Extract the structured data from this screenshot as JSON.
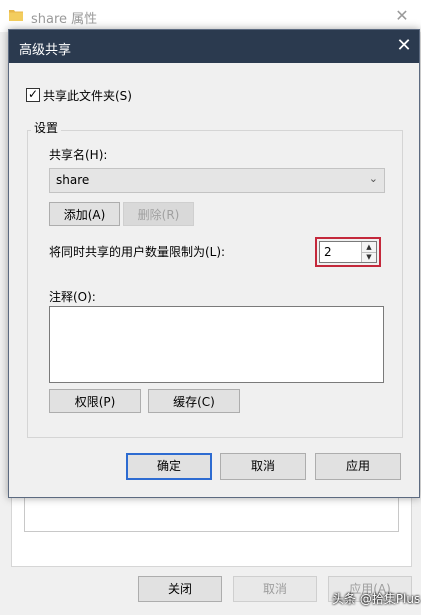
{
  "background_window": {
    "title": "share 属性",
    "close_glyph": "✕",
    "buttons": {
      "close": "关闭",
      "cancel": "取消",
      "apply": "应用(A)"
    }
  },
  "dialog": {
    "title": "高级共享",
    "close_glyph": "✕",
    "share_checkbox": {
      "label": "共享此文件夹(S)",
      "checked": true
    },
    "settings_group": "设置",
    "share_name_label": "共享名(H):",
    "share_name_value": "share",
    "add_button": "添加(A)",
    "delete_button": "删除(R)",
    "user_limit_label": "将同时共享的用户数量限制为(L):",
    "user_limit_value": "2",
    "comment_label": "注释(O):",
    "comment_value": "",
    "permissions_button": "权限(P)",
    "caching_button": "缓存(C)",
    "ok_button": "确定",
    "cancel_button": "取消",
    "apply_button": "应用"
  },
  "colors": {
    "dialog_titlebar": "#2b3a4f",
    "highlight_border": "#c4283b",
    "default_button_border": "#2d6bd1"
  },
  "watermark": "头条 @拾集Plus"
}
